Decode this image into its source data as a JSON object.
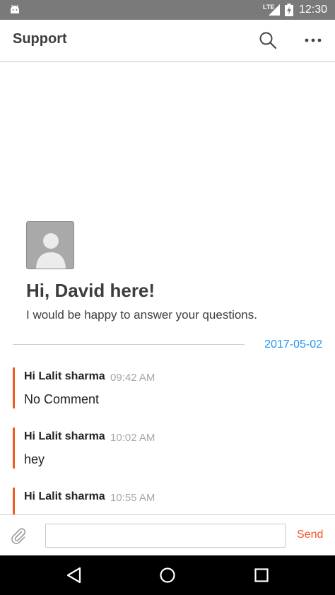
{
  "status_bar": {
    "network": "LTE",
    "time": "12:30"
  },
  "app_bar": {
    "title": "Support",
    "icons": [
      "search-icon",
      "more-options-icon"
    ]
  },
  "intro": {
    "avatar": "default-avatar",
    "heading": "Hi, David here!",
    "subtitle": "I would be happy to answer your questions."
  },
  "date_separator": "2017-05-02",
  "messages": [
    {
      "sender": "Hi Lalit sharma",
      "time": "09:42 AM",
      "text": "No Comment"
    },
    {
      "sender": "Hi Lalit sharma",
      "time": "10:02 AM",
      "text": "hey"
    },
    {
      "sender": "Hi Lalit sharma",
      "time": "10:55 AM",
      "text": ""
    }
  ],
  "composer": {
    "value": "",
    "placeholder": "",
    "send_label": "Send",
    "attach_icon": "paperclip-icon"
  },
  "nav_bar": [
    "back-icon",
    "home-icon",
    "recents-icon"
  ],
  "colors": {
    "accent": "#f15a22",
    "date": "#2196f3",
    "status_bar": "#7a7a7a",
    "time_text": "#a8a8a8"
  }
}
